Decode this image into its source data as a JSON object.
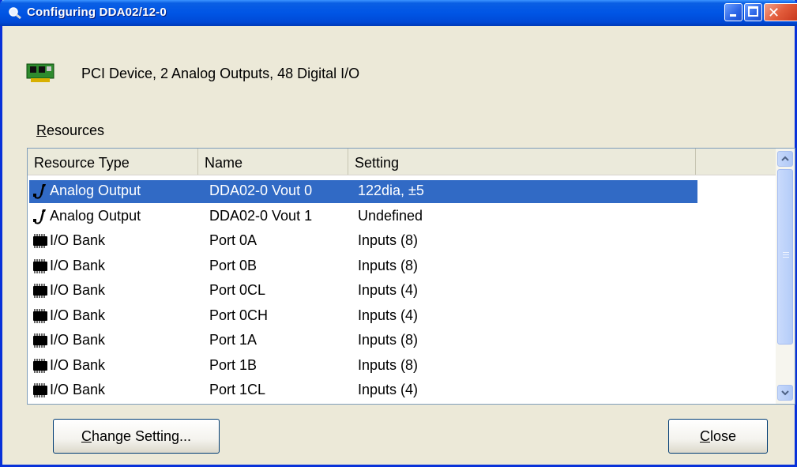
{
  "window": {
    "title": "Configuring DDA02/12-0",
    "min_button": "minimize",
    "max_button": "maximize",
    "close_button": "close"
  },
  "device": {
    "icon": "pci-card-icon",
    "description": "PCI Device, 2 Analog Outputs, 48 Digital I/O"
  },
  "resources": {
    "label_underlined": "R",
    "label_rest": "esources",
    "columns": [
      "Resource Type",
      "Name",
      "Setting",
      ""
    ],
    "rows": [
      {
        "type": "Analog Output",
        "name": "DDA02-0 Vout 0",
        "setting": "122dia, ±5",
        "icon": "analog-output-icon",
        "selected": true
      },
      {
        "type": "Analog Output",
        "name": "DDA02-0 Vout 1",
        "setting": "Undefined",
        "icon": "analog-output-icon",
        "selected": false
      },
      {
        "type": "I/O Bank",
        "name": "Port 0A",
        "setting": "Inputs  (8)",
        "icon": "io-bank-chip-icon",
        "selected": false
      },
      {
        "type": "I/O Bank",
        "name": "Port 0B",
        "setting": "Inputs  (8)",
        "icon": "io-bank-chip-icon",
        "selected": false
      },
      {
        "type": "I/O Bank",
        "name": "Port 0CL",
        "setting": "Inputs  (4)",
        "icon": "io-bank-chip-icon",
        "selected": false
      },
      {
        "type": "I/O Bank",
        "name": "Port 0CH",
        "setting": "Inputs  (4)",
        "icon": "io-bank-chip-icon",
        "selected": false
      },
      {
        "type": "I/O Bank",
        "name": "Port 1A",
        "setting": "Inputs  (8)",
        "icon": "io-bank-chip-icon",
        "selected": false
      },
      {
        "type": "I/O Bank",
        "name": "Port 1B",
        "setting": "Inputs  (8)",
        "icon": "io-bank-chip-icon",
        "selected": false
      },
      {
        "type": "I/O Bank",
        "name": "Port 1CL",
        "setting": "Inputs  (4)",
        "icon": "io-bank-chip-icon",
        "selected": false
      }
    ]
  },
  "buttons": {
    "change_underlined": "C",
    "change_rest": "hange Setting...",
    "close_underlined": "C",
    "close_rest": "lose"
  },
  "colors": {
    "titlebar": "#0055e5",
    "selection": "#316ac5",
    "dialog_bg": "#ece9d8"
  }
}
